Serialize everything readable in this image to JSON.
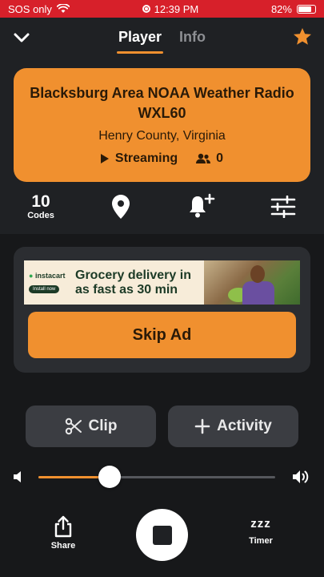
{
  "status_bar": {
    "carrier": "SOS only",
    "time": "12:39 PM",
    "battery": "82%",
    "battery_level": 0.82
  },
  "nav": {
    "tabs": [
      {
        "label": "Player",
        "active": true
      },
      {
        "label": "Info",
        "active": false
      }
    ],
    "back_icon": "chevron-down-icon",
    "favorite_icon": "star-icon"
  },
  "station": {
    "name": "Blacksburg Area NOAA Weather Radio WXL60",
    "location": "Henry County, Virginia",
    "status": "Streaming",
    "listeners": "0"
  },
  "toolbar": {
    "codes_count": "10",
    "codes_label": "Codes"
  },
  "ad": {
    "brand": "instacart",
    "install_label": "Install now",
    "headline": "Grocery delivery in as fast as 30 min",
    "skip_label": "Skip Ad"
  },
  "actions": {
    "clip_label": "Clip",
    "activity_label": "Activity"
  },
  "volume": {
    "level": 0.3
  },
  "bottom": {
    "share_label": "Share",
    "timer_label": "Timer",
    "timer_glyph": "zzz"
  },
  "colors": {
    "accent": "#f0902f",
    "background": "#1f2124",
    "status_bar": "#d7202a"
  }
}
